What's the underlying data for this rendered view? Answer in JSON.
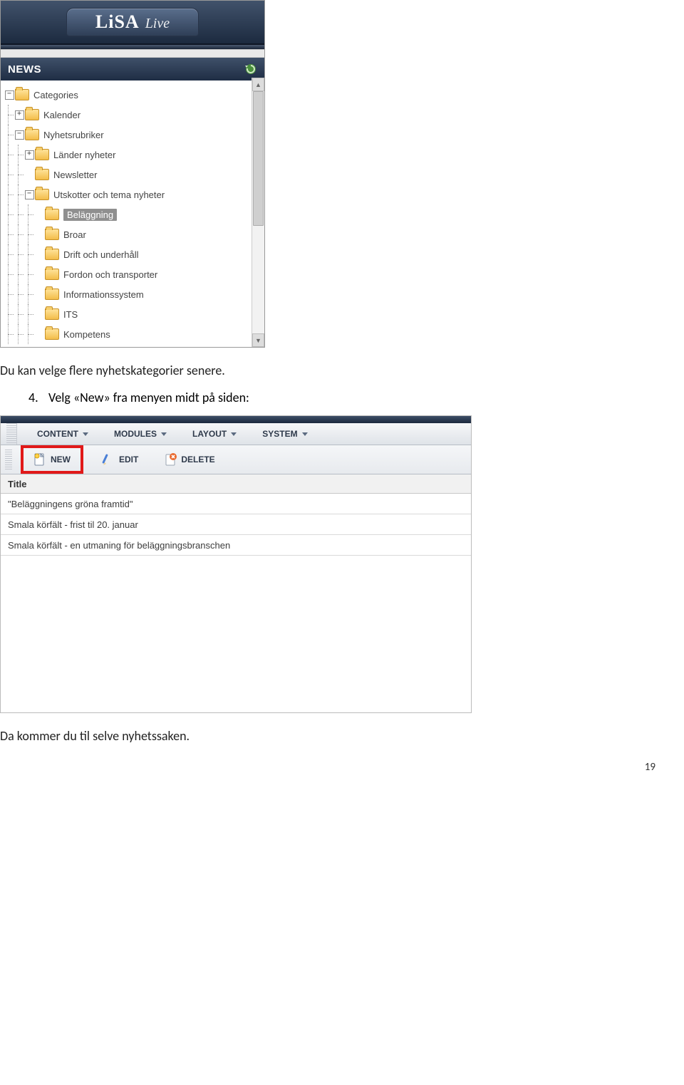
{
  "page_number": "19",
  "shot1": {
    "logo_main": "LiSA",
    "logo_sub": "Live",
    "panel_title": "NEWS",
    "tree": {
      "root": "Categories",
      "kalender": "Kalender",
      "nyhetsrubriker": "Nyhetsrubriker",
      "lander": "Länder nyheter",
      "newsletter": "Newsletter",
      "utskotter": "Utskotter och tema nyheter",
      "belaggning": "Beläggning",
      "broar": "Broar",
      "drift": "Drift och underhåll",
      "fordon": "Fordon och transporter",
      "infosys": "Informationssystem",
      "its": "ITS",
      "kompetens": "Kompetens"
    }
  },
  "paragraph1": "Du kan velge flere nyhetskategorier senere.",
  "step": {
    "num": "4.",
    "text": "Velg «New» fra menyen midt på siden:"
  },
  "shot2": {
    "menu": {
      "content": "CONTENT",
      "modules": "MODULES",
      "layout": "LAYOUT",
      "system": "SYSTEM"
    },
    "tools": {
      "new": "NEW",
      "edit": "EDIT",
      "delete": "DELETE"
    },
    "title_header": "Title",
    "rows": [
      "\"Beläggningens gröna framtid\"",
      "Smala körfält - frist til 20. januar",
      "Smala körfält - en utmaning för beläggningsbranschen"
    ]
  },
  "paragraph2": "Da kommer du til selve nyhetssaken."
}
